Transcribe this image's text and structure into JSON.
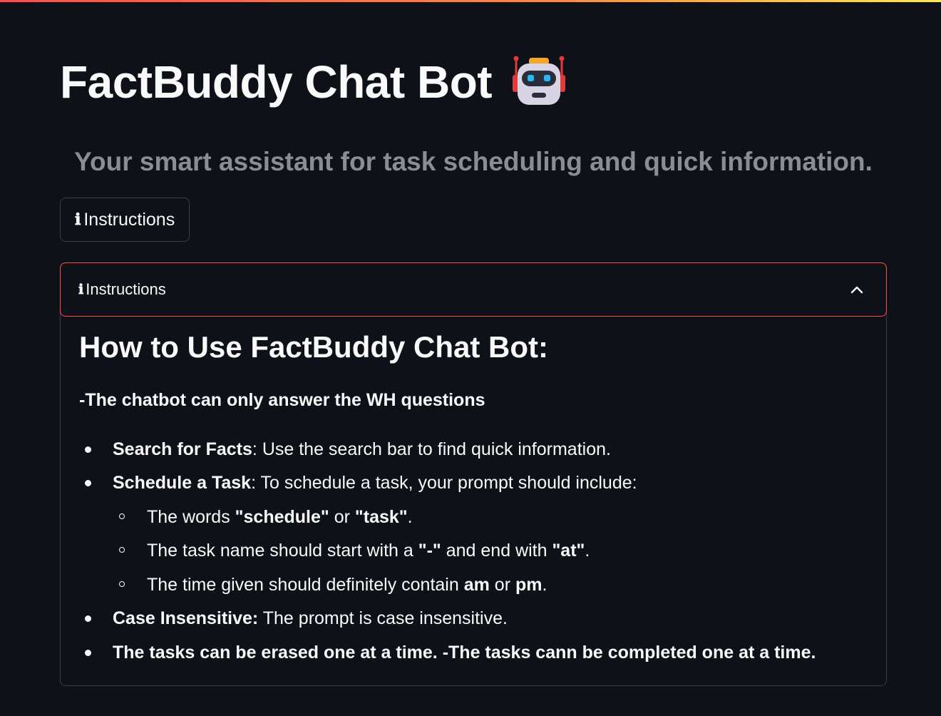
{
  "header": {
    "title": "FactBuddy Chat Bot",
    "title_icon": "robot-icon",
    "subtitle": "Your smart assistant for task scheduling and quick information."
  },
  "instructions_button": {
    "icon": "ℹ",
    "label": "Instructions"
  },
  "expander": {
    "icon": "ℹ",
    "label": "Instructions",
    "expanded": true,
    "chevron_icon": "chevron-up-icon",
    "heading": "How to Use FactBuddy Chat Bot:",
    "note": "-The chatbot can only answer the WH questions",
    "items": [
      {
        "bold": "Search for Facts",
        "text": ": Use the search bar to find quick information."
      },
      {
        "bold": "Schedule a Task",
        "text": ": To schedule a task, your prompt should include:"
      }
    ],
    "sub_items": [
      {
        "t1": "The words ",
        "b1": "\"schedule\"",
        "t2": " or ",
        "b2": "\"task\"",
        "t3": "."
      },
      {
        "t1": "The task name should start with a ",
        "b1": "\"-\"",
        "t2": " and end with ",
        "b2": "\"at\"",
        "t3": "."
      },
      {
        "t1": "The time given should definitely contain ",
        "b1": "am",
        "t2": " or ",
        "b2": "pm",
        "t3": "."
      }
    ],
    "items_after": [
      {
        "bold": "Case Insensitive:",
        "text": " The prompt is case insensitive."
      },
      {
        "bold": "The tasks can be erased one at a time. -The tasks cann be completed one at a time.",
        "text": ""
      }
    ]
  },
  "colors": {
    "background": "#0e1117",
    "accent": "#ff4b4b",
    "subtitle": "#8a8d93"
  }
}
